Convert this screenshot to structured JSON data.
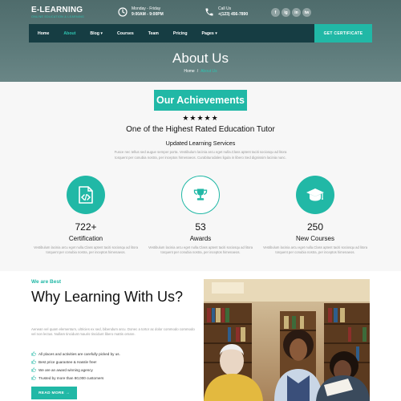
{
  "brand": {
    "name": "E-LEARNING",
    "tagline": "ONLINE EDUCATION & LEARNING"
  },
  "contact": {
    "hours_line1": "Monday - Friday",
    "hours_line2": "9:00AM - 9:00PM",
    "call_label": "Call Us",
    "phone": "+(123) 456-7890"
  },
  "social": [
    "f",
    "ig",
    "in",
    "tw"
  ],
  "nav": {
    "items": [
      {
        "label": "Home"
      },
      {
        "label": "About",
        "active": true
      },
      {
        "label": "Blog ▾"
      },
      {
        "label": "Courses"
      },
      {
        "label": "Team"
      },
      {
        "label": "Pricing"
      },
      {
        "label": "Pages ▾"
      }
    ],
    "cta": "GET CERTIFICATE"
  },
  "hero": {
    "title": "About Us",
    "breadcrumb_home": "Home",
    "breadcrumb_sep": "/",
    "breadcrumb_current": "About Us"
  },
  "achievements": {
    "badge": "Our Achievements",
    "stars": "★★★★★",
    "heading": "One of the Highest Rated Education Tutor",
    "subheading": "Updated Learning Services",
    "paragraph": "Fusce nec tellus sed augue semper porta. Vestibulum lacinia arcu eget nulla.Class aptent taciti sociosqu ad litora torquent per conubia nostra, per inceptos himenaeos. Curabiturodales ligula in libero Sed dignissim lacinia nunc.",
    "stats": [
      {
        "value": "722+",
        "label": "Certification",
        "icon": "code-file-icon",
        "desc": "Vestibulum lacinia arcu eget nulla.Class aptent taciti sociosqu ad litora torquent per conubia nostra, per inceptos himenaeos."
      },
      {
        "value": "53",
        "label": "Awards",
        "icon": "trophy-icon",
        "desc": "Vestibulum lacinia arcu eget nulla.Class aptent taciti sociosqu ad litora torquent per conubia nostra, per inceptos himenaeos."
      },
      {
        "value": "250",
        "label": "New Courses",
        "icon": "graduation-cap-icon",
        "desc": "Vestibulum lacinia arcu eget nulla.Class aptent taciti sociosqu ad litora torquent per conubia nostra, per inceptos himenaeos."
      }
    ]
  },
  "why": {
    "kicker": "We are Best",
    "title": "Why Learning With Us?",
    "paragraph": "Aenean vel quam elementum, ultricies ex sed, bibendum arcu. Donec a tortor ac dolor commodo commodo vel non lectus. Nullam tincidunt mauris tincidunt libero mattis ornare.",
    "list": [
      {
        "icon": "thumbs-up-icon",
        "text": "All places and activities are carefully picked by us."
      },
      {
        "icon": "thumbs-up-icon",
        "text": "Best price guarantee & Hassle free!"
      },
      {
        "icon": "thumbs-up-icon",
        "text": "We are an award winning agency"
      },
      {
        "icon": "thumbs-up-icon",
        "text": "Trusted by more than 80,000 customers"
      }
    ],
    "button": "READ MORE →"
  },
  "colors": {
    "accent": "#21b8a6",
    "nav_bg": "#163d43",
    "hero_bg": "#5a7878"
  }
}
